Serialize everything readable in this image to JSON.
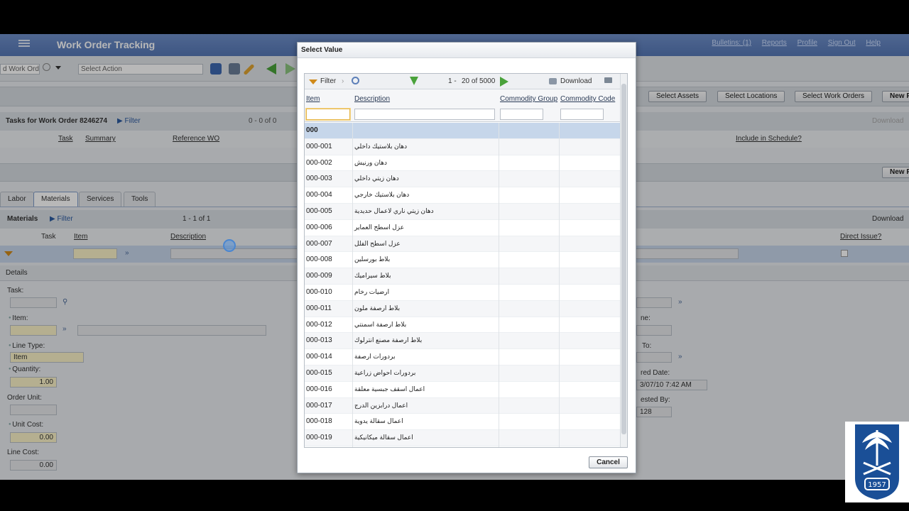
{
  "app": {
    "title": "Work Order Tracking",
    "links": [
      "Bulletins: (1)",
      "Reports",
      "Profile",
      "Sign Out",
      "Help"
    ],
    "search_value": "d Work Orde",
    "select_action": "Select Action"
  },
  "buttons": {
    "select_assets": "Select Assets",
    "select_locations": "Select Locations",
    "select_work_orders": "Select Work Orders",
    "new_row": "New R",
    "new_row2": "New R"
  },
  "tasks": {
    "title": "Tasks for Work Order 8246274",
    "filter": "Filter",
    "count": "0 - 0 of 0",
    "download": "Download",
    "columns": [
      "Task",
      "Summary",
      "Reference WO"
    ],
    "include": "Include in Schedule?"
  },
  "tabs": [
    "Labor",
    "Materials",
    "Services",
    "Tools"
  ],
  "materials": {
    "title": "Materials",
    "filter": "Filter",
    "count": "1 - 1 of 1",
    "download": "Download",
    "columns": [
      "Task",
      "Item",
      "Description"
    ],
    "direct_issue": "Direct Issue?"
  },
  "details": {
    "title": "Details",
    "task_label": "Task:",
    "item_label": "Item:",
    "line_type_label": "Line Type:",
    "line_type_value": "Item",
    "quantity_label": "Quantity:",
    "quantity_value": "1.00",
    "order_unit_label": "Order Unit:",
    "unit_cost_label": "Unit Cost:",
    "unit_cost_value": "0.00",
    "line_cost_label": "Line Cost:",
    "line_cost_value": "0.00",
    "right_name_label": "ne:",
    "right_to_label": "To:",
    "right_date_label": "red Date:",
    "right_date_value": "3/07/10 7:42 AM",
    "right_req_label": "ested By:",
    "right_req_value": "128"
  },
  "modal": {
    "title": "Select Value",
    "filter": "Filter",
    "range": "1 -",
    "count": "20 of 5000",
    "download": "Download",
    "columns": [
      "Item",
      "Description",
      "Commodity Group",
      "Commodity Code"
    ],
    "rows": [
      {
        "item": "000",
        "desc": ""
      },
      {
        "item": "000-001",
        "desc": "دهان بلاستيك داخلي"
      },
      {
        "item": "000-002",
        "desc": "دهان ورنيش"
      },
      {
        "item": "000-003",
        "desc": "دهان زيتي داخلي"
      },
      {
        "item": "000-004",
        "desc": "دهان بلاستيك خارجي"
      },
      {
        "item": "000-005",
        "desc": "دهان زيتي ناري لاعمال حديدية"
      },
      {
        "item": "000-006",
        "desc": "عزل اسطح العماير"
      },
      {
        "item": "000-007",
        "desc": "عزل اسطح الفلل"
      },
      {
        "item": "000-008",
        "desc": "بلاط بورسلين"
      },
      {
        "item": "000-009",
        "desc": "بلاط سيراميك"
      },
      {
        "item": "000-010",
        "desc": "ارضيات رخام"
      },
      {
        "item": "000-011",
        "desc": "بلاط ارصفة ملون"
      },
      {
        "item": "000-012",
        "desc": "بلاط ارصفة اسمنتي"
      },
      {
        "item": "000-013",
        "desc": "بلاط ارصفة مصنع انترلوك"
      },
      {
        "item": "000-014",
        "desc": "بردورات ارصفة"
      },
      {
        "item": "000-015",
        "desc": "بردورات احواض زراعية"
      },
      {
        "item": "000-016",
        "desc": "اعمال اسقف جبسية معلقة"
      },
      {
        "item": "000-017",
        "desc": "اعمال درابزين الدرج"
      },
      {
        "item": "000-018",
        "desc": "اعمال سقالة يدوية"
      },
      {
        "item": "000-019",
        "desc": "اعمال سقالة ميكانيكية"
      }
    ],
    "cancel": "Cancel"
  },
  "logo": {
    "year": "1957"
  },
  "colors": {
    "accent": "#5577b5",
    "selected_row": "#c6d6ea"
  }
}
